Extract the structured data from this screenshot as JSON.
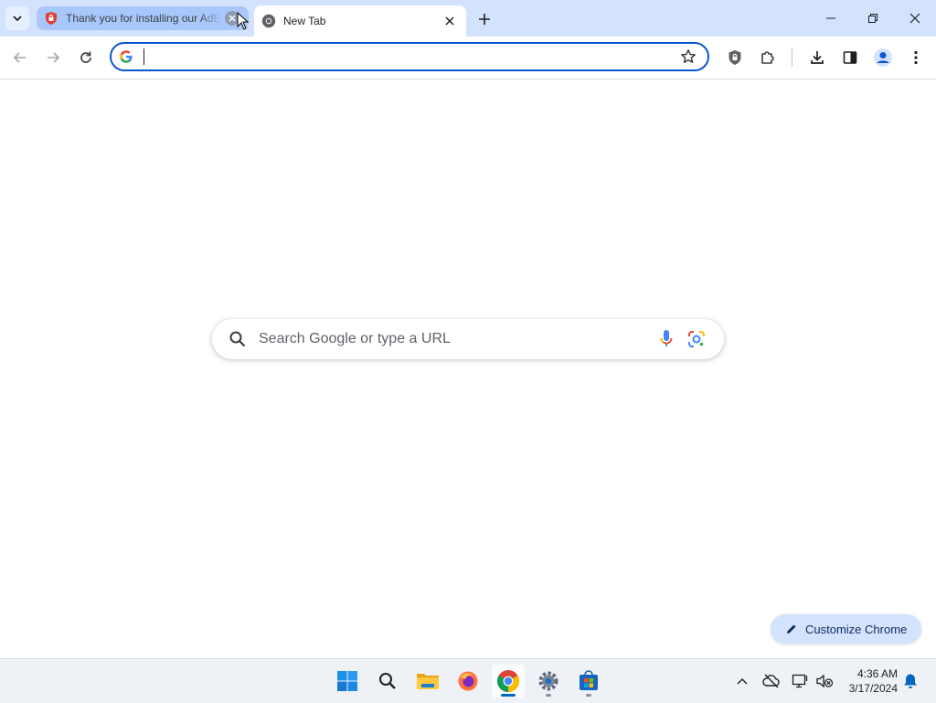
{
  "tabs": [
    {
      "title": "Thank you for installing our AdBlock",
      "icon": "adblock-shield-icon",
      "state": "inactive"
    },
    {
      "title": "New Tab",
      "icon": "chrome-icon",
      "state": "active"
    }
  ],
  "omnibox": {
    "value": "",
    "placeholder": ""
  },
  "ntp": {
    "search_placeholder": "Search Google or type a URL"
  },
  "customize_label": "Customize Chrome",
  "taskbar": {
    "apps": [
      "windows-start-icon",
      "search-icon",
      "file-explorer-icon",
      "firefox-icon",
      "chrome-icon",
      "settings-icon",
      "microsoft-store-icon"
    ]
  },
  "clock": {
    "time": "4:36 AM",
    "date": "3/17/2024"
  },
  "colors": {
    "accent": "#0b57d0",
    "tabstrip": "#d3e3fd",
    "customize_bg": "#d3e3fd"
  }
}
